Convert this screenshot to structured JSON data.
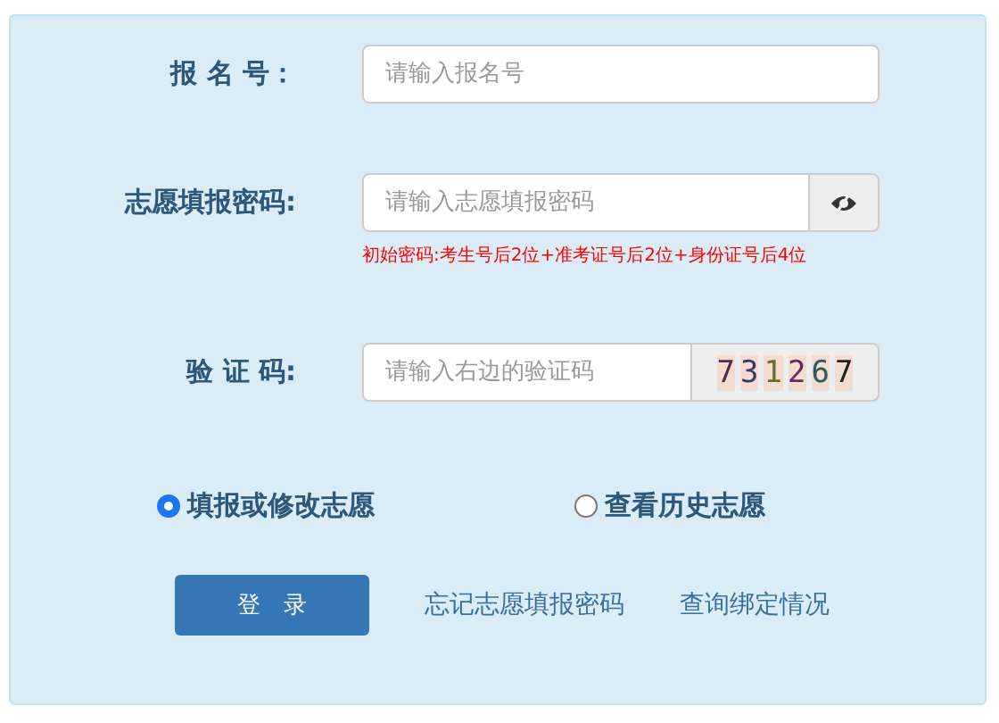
{
  "fields": [
    {
      "label": "报 名 号：",
      "placeholder": "请输入报名号",
      "kind": "text"
    },
    {
      "label": "志愿填报密码:",
      "placeholder": "请输入志愿填报密码",
      "kind": "password",
      "hint": "初始密码:考生号后2位+准考证号后2位+身份证号后4位"
    },
    {
      "label": "验 证 码:",
      "placeholder": "请输入右边的验证码",
      "kind": "captcha",
      "captcha": "731267"
    }
  ],
  "options": [
    {
      "label": "填报或修改志愿",
      "selected": true
    },
    {
      "label": "查看历史志愿",
      "selected": false
    }
  ],
  "login_button": "登　录",
  "links": [
    "忘记志愿填报密码",
    "查询绑定情况"
  ]
}
